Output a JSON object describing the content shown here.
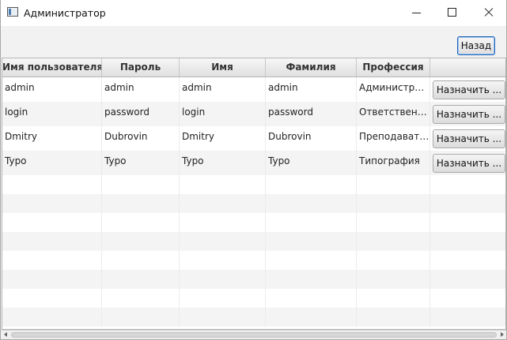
{
  "window": {
    "title": "Администратор"
  },
  "toolbar": {
    "back_label": "Назад"
  },
  "table": {
    "columns": [
      "Имя пользователя",
      "Пароль",
      "Имя",
      "Фамилия",
      "Профессия",
      ""
    ],
    "rows": [
      {
        "username": "admin",
        "password": "admin",
        "first_name": "admin",
        "last_name": "admin",
        "profession": "Администратор",
        "action": "Назначить ..."
      },
      {
        "username": "login",
        "password": "password",
        "first_name": "login",
        "last_name": "password",
        "profession": "Ответственны...",
        "action": "Назначить ..."
      },
      {
        "username": "Dmitry",
        "password": "Dubrovin",
        "first_name": "Dmitry",
        "last_name": "Dubrovin",
        "profession": "Преподаватель",
        "action": "Назначить ..."
      },
      {
        "username": "Typo",
        "password": "Typo",
        "first_name": "Typo",
        "last_name": "Typo",
        "profession": "Типография",
        "action": "Назначить ..."
      }
    ]
  },
  "icons": {
    "app": "app-window-icon",
    "minimize": "minimize-icon",
    "maximize": "maximize-icon",
    "close": "close-icon"
  },
  "colors": {
    "focus_border": "#1e63b8",
    "header_bg": "#e6e6e6"
  }
}
